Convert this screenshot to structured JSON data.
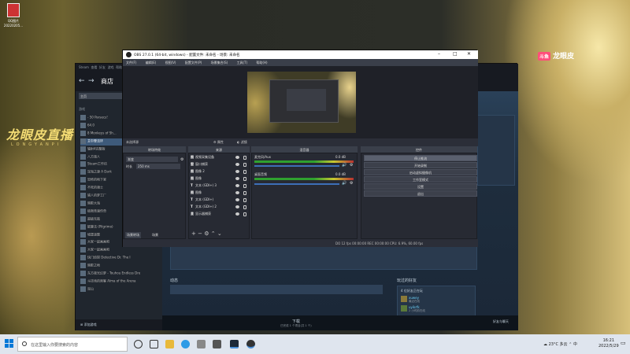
{
  "desktop": {
    "icon_label": "QQ图片\n20220205..."
  },
  "overlay": {
    "douyu_badge": "斗鱼",
    "douyu_name": "龙眼皮",
    "live_logo": "龙眼皮直播",
    "live_sub": "LONGYANPI"
  },
  "steam": {
    "menu": [
      "Steam",
      "查看",
      "好友",
      "游戏",
      "帮助"
    ],
    "store_tab": "商店",
    "sidebar_search": "主页",
    "sidebar_section": "游戏",
    "games": [
      "- 50 Parsecs!",
      "64.0",
      "8 Monkeys of Sh...",
      "艾尔登法环",
      "辐射4完整版",
      "八方旅人",
      "Steam工作坊",
      "深海之源 A Dark",
      "恐怖的地下室",
      "不死的骑士",
      "猎人的梦工厂",
      "暗影大海",
      "极限竞速传奇",
      "超级无敌",
      "能算法 (Pilgrimo)",
      "城堡谜题",
      "大家一起画画吧",
      "大家一起画画吧",
      "快门侦探 Detective Dr. The I",
      "暗影之地",
      "东方夜光幻梦 - Touhou Endless Dre",
      "斗技场的刺客 Alma of the Arena",
      "泥山"
    ],
    "add_game": "添加游戏",
    "download": "下载",
    "download_sub": "已完成 1 个项目(共 1 个)",
    "friends": "好友与聊天",
    "activity": "动态",
    "friend_playing": "玩过的好友",
    "friend_header": "4 位好友正在玩",
    "friends_list": [
      {
        "name": "xuwey",
        "status": "最近在线"
      },
      {
        "name": "uyikrfk",
        "status": "2 小时前在线"
      }
    ]
  },
  "obs": {
    "title": "OBS 27.0.1 (64-bit, windows) - 配置文件: 未命名 - 场景: 未命名",
    "menu": [
      "文件(F)",
      "编辑(E)",
      "视图(V)",
      "配置文件(P)",
      "场景集合(S)",
      "工具(T)",
      "帮助(H)"
    ],
    "scene_bar_text": "未选择源",
    "props": "属性",
    "filters": "滤镜",
    "docks": {
      "transitions": "转场特效",
      "sources": "来源",
      "mixer": "混音器",
      "controls": "控件"
    },
    "transition": {
      "type": "渐变",
      "duration_label": "时长",
      "duration": "250 ms"
    },
    "scenes_tabs": [
      "场景转场",
      "场景"
    ],
    "sources": [
      {
        "type": "图",
        "name": "视频采集设备"
      },
      {
        "type": "窗",
        "name": "窗口捕获"
      },
      {
        "type": "图",
        "name": "图像 2"
      },
      {
        "type": "图",
        "name": "图像"
      },
      {
        "type": "T",
        "name": "文本 (GDI+) 3"
      },
      {
        "type": "图",
        "name": "图像"
      },
      {
        "type": "T",
        "name": "文本 (GDI+)"
      },
      {
        "type": "T",
        "name": "文本 (GDI+) 2"
      },
      {
        "type": "显",
        "name": "显示器捕获"
      }
    ],
    "mixer": [
      {
        "name": "桌面音频",
        "db": "0.0 dB"
      },
      {
        "name": "麦克风/Aux",
        "db": "0.0 dB"
      }
    ],
    "controls": [
      "停止推流",
      "开始录制",
      "启动虚拟摄像机",
      "工作室模式",
      "设置",
      "退出"
    ],
    "status": "DO 12 fps  00:00:00  REC 00:00:00  CPU: 6.9%, 60.00 fps"
  },
  "taskbar": {
    "search_placeholder": "在这里输入你要搜索的内容",
    "weather": "23°C 多云",
    "ime": "中",
    "time": "16:21",
    "date": "2022/5/29"
  }
}
